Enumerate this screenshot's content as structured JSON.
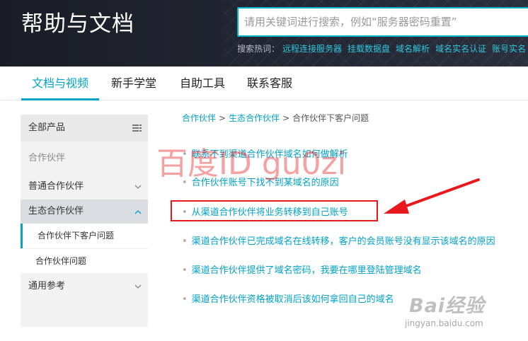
{
  "header": {
    "title": "帮助与文档",
    "search_placeholder": "请用关键词进行搜索，例如“服务器密码重置”",
    "hot_label": "搜索热词：",
    "hot_terms": [
      "远程连接服务器",
      "挂载数据盘",
      "域名解析",
      "域名实名认证",
      "账号实名"
    ]
  },
  "tabs": [
    {
      "label": "文档与视频",
      "active": true
    },
    {
      "label": "新手学堂",
      "active": false
    },
    {
      "label": "自助工具",
      "active": false
    },
    {
      "label": "联系客服",
      "active": false
    }
  ],
  "sidebar": {
    "all_products": "全部产品",
    "partner_heading": "合作伙伴",
    "items": [
      {
        "label": "普通合作伙伴",
        "icon": "chevron-down-icon"
      },
      {
        "label": "生态合作伙伴",
        "icon": "chevron-up-icon",
        "expanded": true
      },
      {
        "label": "合作伙伴下客户问题",
        "selected": true
      },
      {
        "label": "合作伙伴问题"
      },
      {
        "label": "通用参考",
        "icon": "chevron-down-icon"
      }
    ]
  },
  "breadcrumb": [
    "合作伙伴",
    "生态合作伙伴",
    "合作伙伴下客户问题"
  ],
  "articles": [
    "联系不到渠道合作伙伴域名如何做解析",
    "合作伙伴账号下找不到某域名的原因",
    "从渠道合作伙伴将业务转移到自己账号",
    "渠道合作伙伴已完成域名在线转移，客户的会员账号没有显示该域名的原因",
    "渠道合作伙伴提供了域名密码，我要在哪里登陆管理域名",
    "渠道合作伙伴资格被取消后该如何拿回自己的域名"
  ],
  "watermark": {
    "red_text": "百度ID gu0zi",
    "brand": "Bai经验",
    "url": "jingyan.baidu.com"
  },
  "colors": {
    "accent": "#00a2ca",
    "header_bg": "#1f222c",
    "annotation_red": "#e8191c"
  }
}
